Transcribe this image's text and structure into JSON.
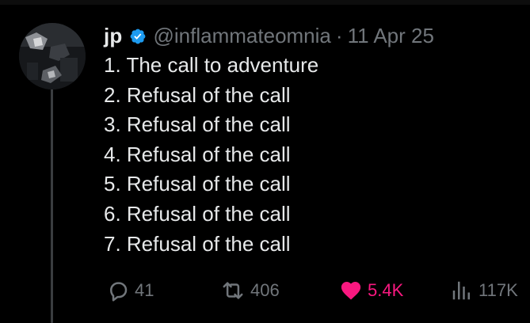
{
  "tweet": {
    "author": {
      "display_name": "jp",
      "handle": "@inflammateomnia",
      "verified": true,
      "avatar": "dark-photo-avatar"
    },
    "separator": "·",
    "date": "11 Apr 25",
    "body_lines": [
      "1. The call to adventure",
      "2. Refusal of the call",
      "3. Refusal of the call",
      "4. Refusal of the call",
      "5. Refusal of the call",
      "6. Refusal of the call",
      "7. Refusal of the call"
    ],
    "actions": {
      "reply": {
        "icon": "reply-icon",
        "count": "41"
      },
      "retweet": {
        "icon": "retweet-icon",
        "count": "406"
      },
      "like": {
        "icon": "heart-icon",
        "count": "5.4K",
        "liked": true
      },
      "views": {
        "icon": "views-icon",
        "count": "117K"
      }
    }
  },
  "colors": {
    "background": "#000000",
    "text_primary": "#e7e9ea",
    "text_secondary": "#71767b",
    "verified_blue": "#1d9bf0",
    "like_pink": "#f91880",
    "thread_line": "#3a3d40"
  }
}
